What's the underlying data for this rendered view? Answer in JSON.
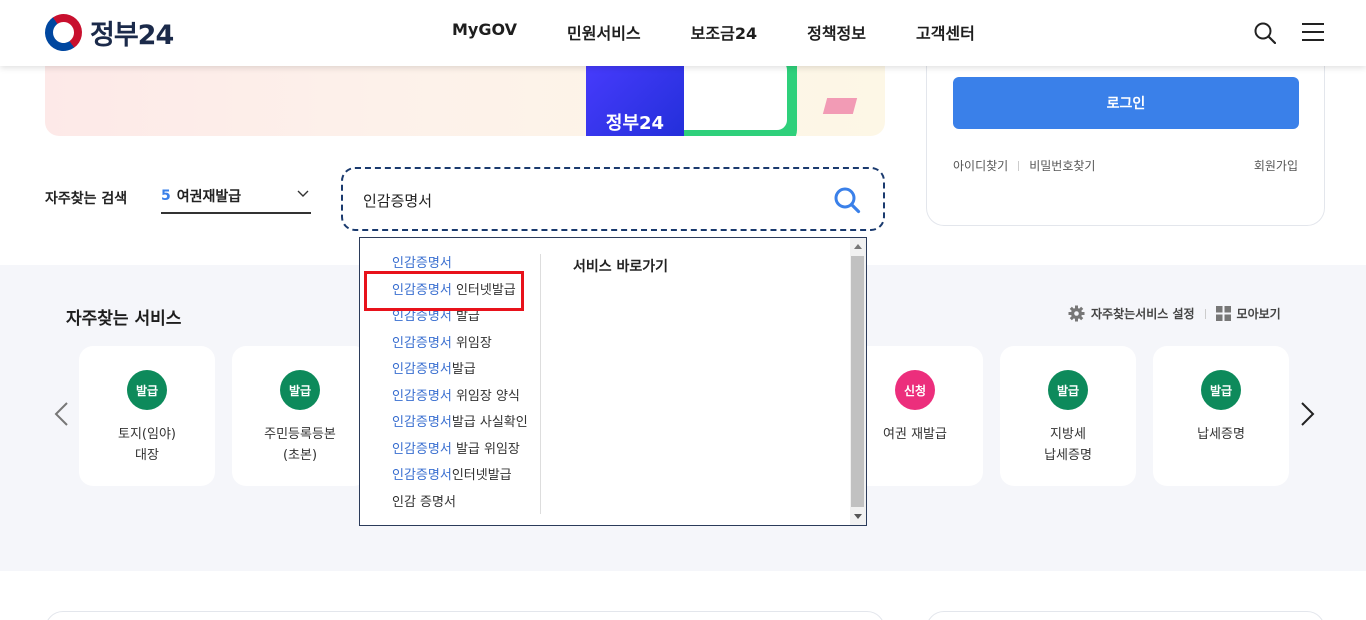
{
  "header": {
    "logo_text": "정부24",
    "nav": [
      "MyGOV",
      "민원서비스",
      "보조금24",
      "정책정보",
      "고객센터"
    ]
  },
  "banner": {
    "phone_text": "정부24"
  },
  "login": {
    "button_label": "로그인",
    "find_id": "아이디찾기",
    "find_password": "비밀번호찾기",
    "join": "회원가입"
  },
  "search": {
    "frequent_label": "자주찾는 검색",
    "selected_rank": "5",
    "selected_term": "여권재발급",
    "value": "인감증명서"
  },
  "autocomplete": {
    "suggestions": [
      {
        "match": "인감증명서",
        "rest": ""
      },
      {
        "match": "인감증명서",
        "rest": " 인터넷발급"
      },
      {
        "match": "인감증명서",
        "rest": " 발급"
      },
      {
        "match": "인감증명서",
        "rest": " 위임장"
      },
      {
        "match": "인감증명서",
        "rest": "발급"
      },
      {
        "match": "인감증명서",
        "rest": " 위임장 양식"
      },
      {
        "match": "인감증명서",
        "rest": "발급 사실확인"
      },
      {
        "match": "인감증명서",
        "rest": " 발급 위임장"
      },
      {
        "match": "인감증명서",
        "rest": "인터넷발급"
      },
      {
        "match": "",
        "rest": "인감 증명서"
      }
    ],
    "service_heading": "서비스 바로가기",
    "highlighted_index": 1
  },
  "frequent_services": {
    "title": "자주찾는 서비스",
    "settings_label": "자주찾는서비스 설정",
    "view_all_label": "모아보기",
    "cards": [
      {
        "badge": "발급",
        "badge_color": "#0d8a5b",
        "label": "토지(임야)\n대장"
      },
      {
        "badge": "발급",
        "badge_color": "#0d8a5b",
        "label": "주민등록등본\n(초본)"
      },
      {
        "badge": "신청",
        "badge_color": "#ec2e7c",
        "label": "여권 재발급"
      },
      {
        "badge": "발급",
        "badge_color": "#0d8a5b",
        "label": "지방세\n납세증명"
      },
      {
        "badge": "발급",
        "badge_color": "#0d8a5b",
        "label": "납세증명"
      }
    ]
  },
  "colors": {
    "accent": "#3a80e9",
    "highlight_text": "#3a6fd0",
    "selection_outline": "#e8121b",
    "section_bg": "#f5f6fa"
  }
}
